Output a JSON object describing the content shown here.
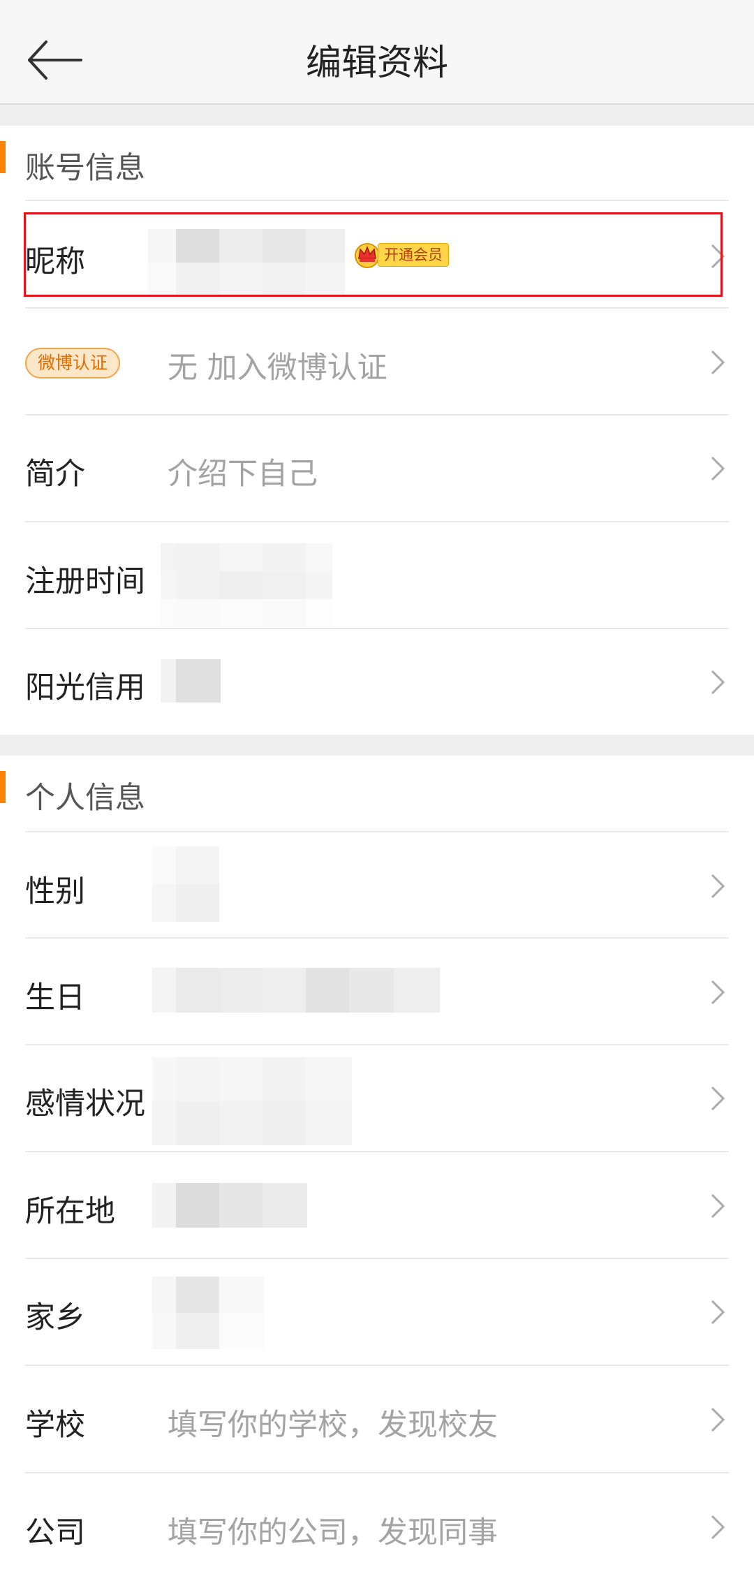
{
  "header": {
    "title": "编辑资料",
    "back_icon": "arrow-left-icon"
  },
  "account": {
    "title": "账号信息",
    "accent_color": "#ff8200",
    "nickname": {
      "label": "昵称",
      "vip_label": "开通会员"
    },
    "verify": {
      "badge": "微博认证",
      "value": "无 加入微博认证"
    },
    "bio": {
      "label": "简介",
      "placeholder": "介绍下自己"
    },
    "register": {
      "label": "注册时间"
    },
    "credit": {
      "label": "阳光信用"
    }
  },
  "personal": {
    "title": "个人信息",
    "gender": {
      "label": "性别"
    },
    "birthday": {
      "label": "生日"
    },
    "relationship": {
      "label": "感情状况"
    },
    "location": {
      "label": "所在地"
    },
    "hometown": {
      "label": "家乡"
    },
    "school": {
      "label": "学校",
      "placeholder": "填写你的学校，发现校友"
    },
    "company": {
      "label": "公司",
      "placeholder": "填写你的公司，发现同事"
    }
  }
}
